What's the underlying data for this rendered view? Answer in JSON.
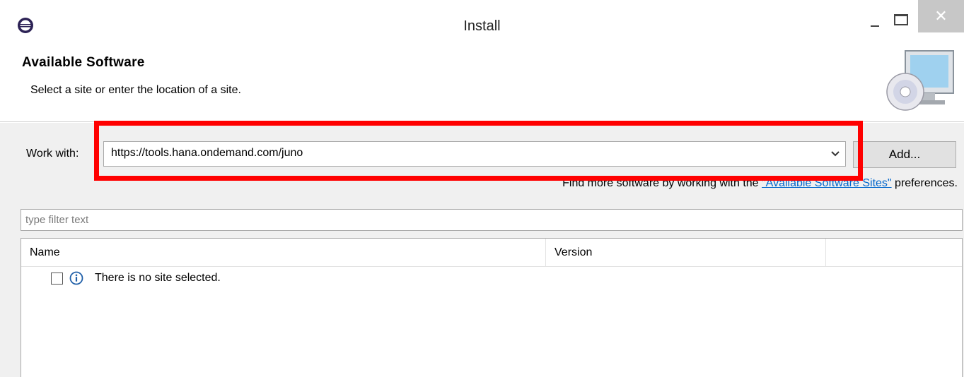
{
  "window": {
    "title": "Install",
    "minimize_icon": "minimize-icon",
    "maximize_icon": "maximize-icon",
    "close_glyph": "✕"
  },
  "banner": {
    "title": "Available Software",
    "description": "Select a site or enter the location of a site.",
    "graphic_icon": "computer-cd-icon"
  },
  "work_with": {
    "label": "Work with:",
    "value": "https://tools.hana.ondemand.com/juno",
    "add_label": "Add..."
  },
  "find_more": {
    "prefix": "Find more software by working with the ",
    "link": "\"Available Software Sites\"",
    "suffix": " preferences."
  },
  "filter": {
    "placeholder": "type filter text"
  },
  "tree": {
    "columns": [
      "Name",
      "Version",
      ""
    ],
    "rows": [
      {
        "checked": false,
        "icon": "info-icon",
        "text": "There is no site selected."
      }
    ]
  },
  "colors": {
    "highlight": "#ff0000",
    "link": "#0066cc",
    "dialog_bg": "#f0f0f0"
  }
}
